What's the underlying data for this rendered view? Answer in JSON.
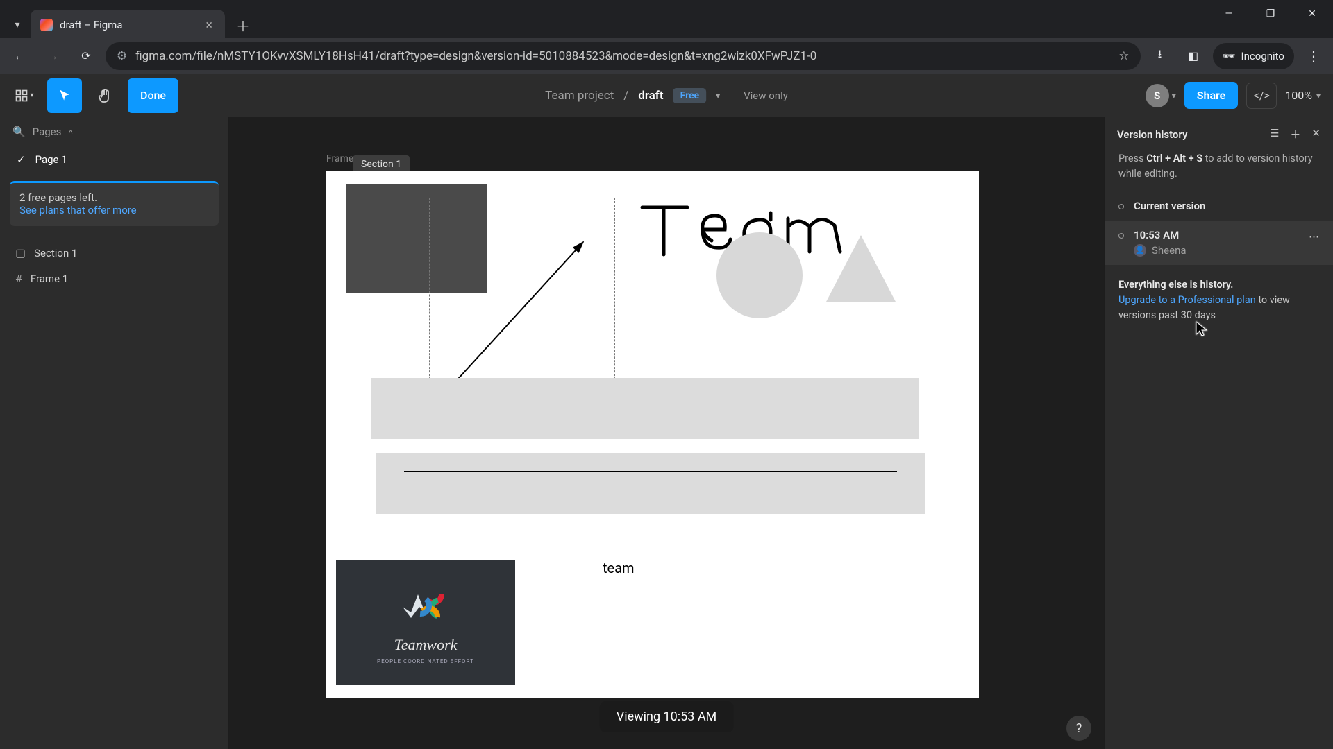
{
  "browser": {
    "tab_title": "draft – Figma",
    "url": "figma.com/file/nMSTY1OKvvXSMLY18HsH41/draft?type=design&version-id=5010884523&mode=design&t=xng2wizk0XFwPJZ1-0",
    "incognito_label": "Incognito"
  },
  "toolbar": {
    "done_label": "Done",
    "breadcrumb": {
      "project": "Team project",
      "file": "draft"
    },
    "plan_badge": "Free",
    "view_mode": "View only",
    "avatar_initial": "S",
    "share_label": "Share",
    "zoom": "100%"
  },
  "left": {
    "pages_label": "Pages",
    "page_name": "Page 1",
    "plan_notice": "2 free pages left.",
    "plan_link": "See plans that offer more",
    "layers": {
      "section": "Section 1",
      "frame": "Frame 1"
    }
  },
  "canvas": {
    "frame_label": "Frame 1",
    "section_chip": "Section 1",
    "handwriting": "Team",
    "text_lower": "team",
    "status": "Viewing 10:53 AM",
    "image_caption": "Teamwork",
    "image_subcaption": "PEOPLE COORDINATED EFFORT"
  },
  "right": {
    "title": "Version history",
    "hint_pre": "Press ",
    "hint_shortcut": "Ctrl + Alt + S",
    "hint_post": " to add to version history while editing.",
    "current": "Current version",
    "entry_time": "10:53 AM",
    "entry_author": "Sheena",
    "upsell_strong": "Everything else is history.",
    "upsell_link": "Upgrade to a Professional plan",
    "upsell_rest": " to view versions past 30 days"
  }
}
